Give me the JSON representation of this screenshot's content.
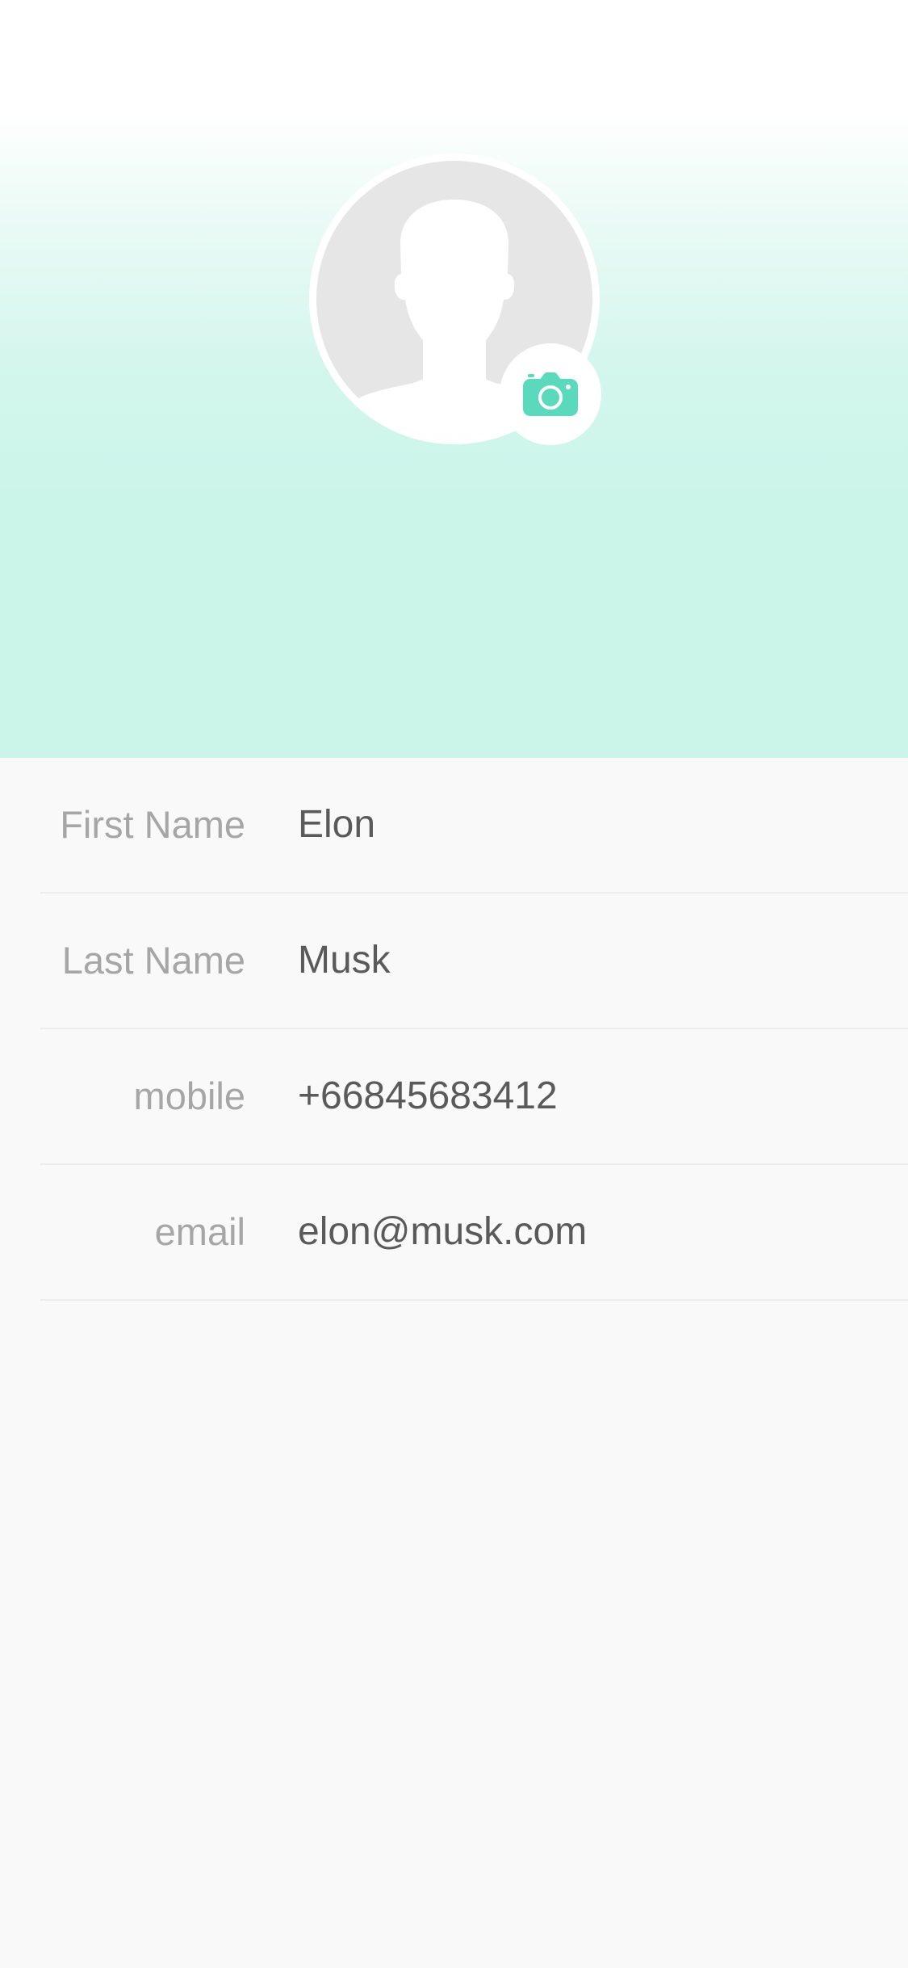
{
  "profile": {
    "avatar_icon": "person-silhouette-icon",
    "camera_icon": "camera-icon",
    "accent_color": "#5ad9bd"
  },
  "fields": [
    {
      "label": "First Name",
      "value": "Elon"
    },
    {
      "label": "Last Name",
      "value": "Musk"
    },
    {
      "label": "mobile",
      "value": "+66845683412"
    },
    {
      "label": "email",
      "value": "elon@musk.com"
    }
  ]
}
